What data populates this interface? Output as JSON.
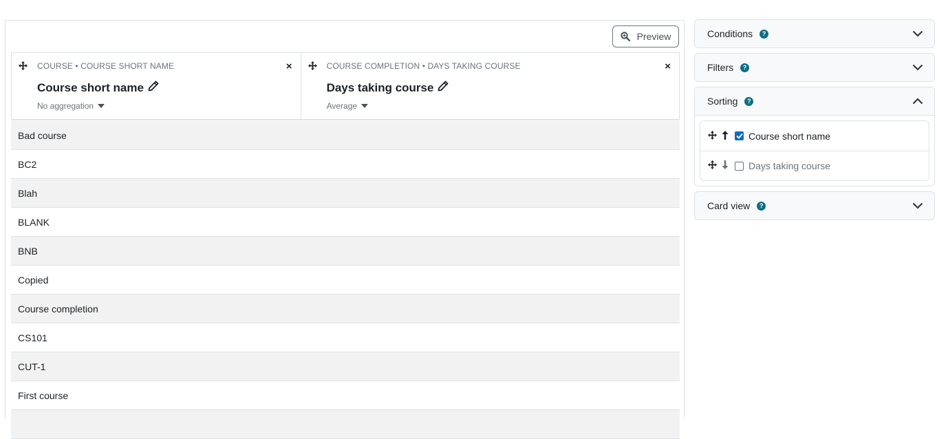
{
  "toolbar": {
    "preview_label": "Preview"
  },
  "columns": [
    {
      "category": "COURSE • COURSE SHORT NAME",
      "title": "Course short name",
      "aggregation": "No aggregation"
    },
    {
      "category": "COURSE COMPLETION • DAYS TAKING COURSE",
      "title": "Days taking course",
      "aggregation": "Average"
    }
  ],
  "rows": [
    "Bad course",
    "BC2",
    "Blah",
    "BLANK",
    "BNB",
    "Copied",
    "Course completion",
    "CS101",
    "CUT-1",
    "First course"
  ],
  "sidebar": {
    "conditions": {
      "label": "Conditions"
    },
    "filters": {
      "label": "Filters"
    },
    "sorting": {
      "label": "Sorting",
      "items": [
        {
          "label": "Course short name",
          "checked": true,
          "direction": "up"
        },
        {
          "label": "Days taking course",
          "checked": false,
          "direction": "down"
        }
      ]
    },
    "card_view": {
      "label": "Card view"
    }
  },
  "colors": {
    "accent": "#0f6cbf",
    "help_icon": "#0f6e84",
    "striped_row": "#f2f2f2",
    "border": "#dee2e6"
  }
}
